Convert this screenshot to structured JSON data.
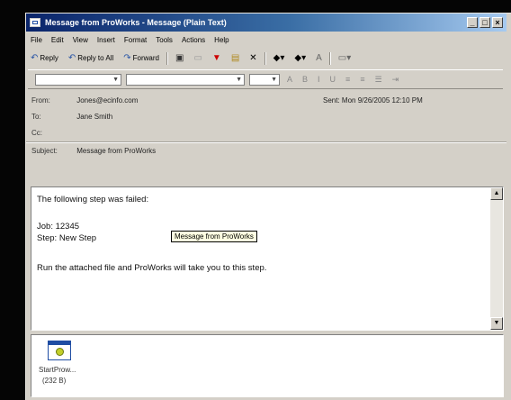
{
  "window": {
    "title": "Message from ProWorks - Message (Plain Text)",
    "buttons": [
      "_",
      "□",
      "×"
    ]
  },
  "menu": [
    "File",
    "Edit",
    "View",
    "Insert",
    "Format",
    "Tools",
    "Actions",
    "Help"
  ],
  "toolbar": {
    "reply": "Reply",
    "reply_all": "Reply to All",
    "forward": "Forward",
    "delete_glyph": "✕",
    "flag_glyph": "▼"
  },
  "header": {
    "from_label": "From:",
    "from_value": "Jones@ecinfo.com",
    "to_label": "To:",
    "to_value": "Jane Smith",
    "cc_label": "Cc:",
    "cc_value": "",
    "subject_label": "Subject:",
    "subject_value": "Message from ProWorks",
    "sent_label": "Sent:",
    "sent_value": "Mon 9/26/2005 12:10 PM"
  },
  "body": {
    "line1": "The following step was failed:",
    "job": "Job:  12345",
    "step": "Step: New Step",
    "line3": "Run the attached file and ProWorks will take you to this step.",
    "tooltip": "Message from ProWorks"
  },
  "attachment": {
    "name": "StartProw...",
    "size": "(232 B)"
  },
  "colors": {
    "title_gradient_start": "#0a246a",
    "title_gradient_end": "#a6caf0",
    "chrome": "#d4d0c8"
  }
}
